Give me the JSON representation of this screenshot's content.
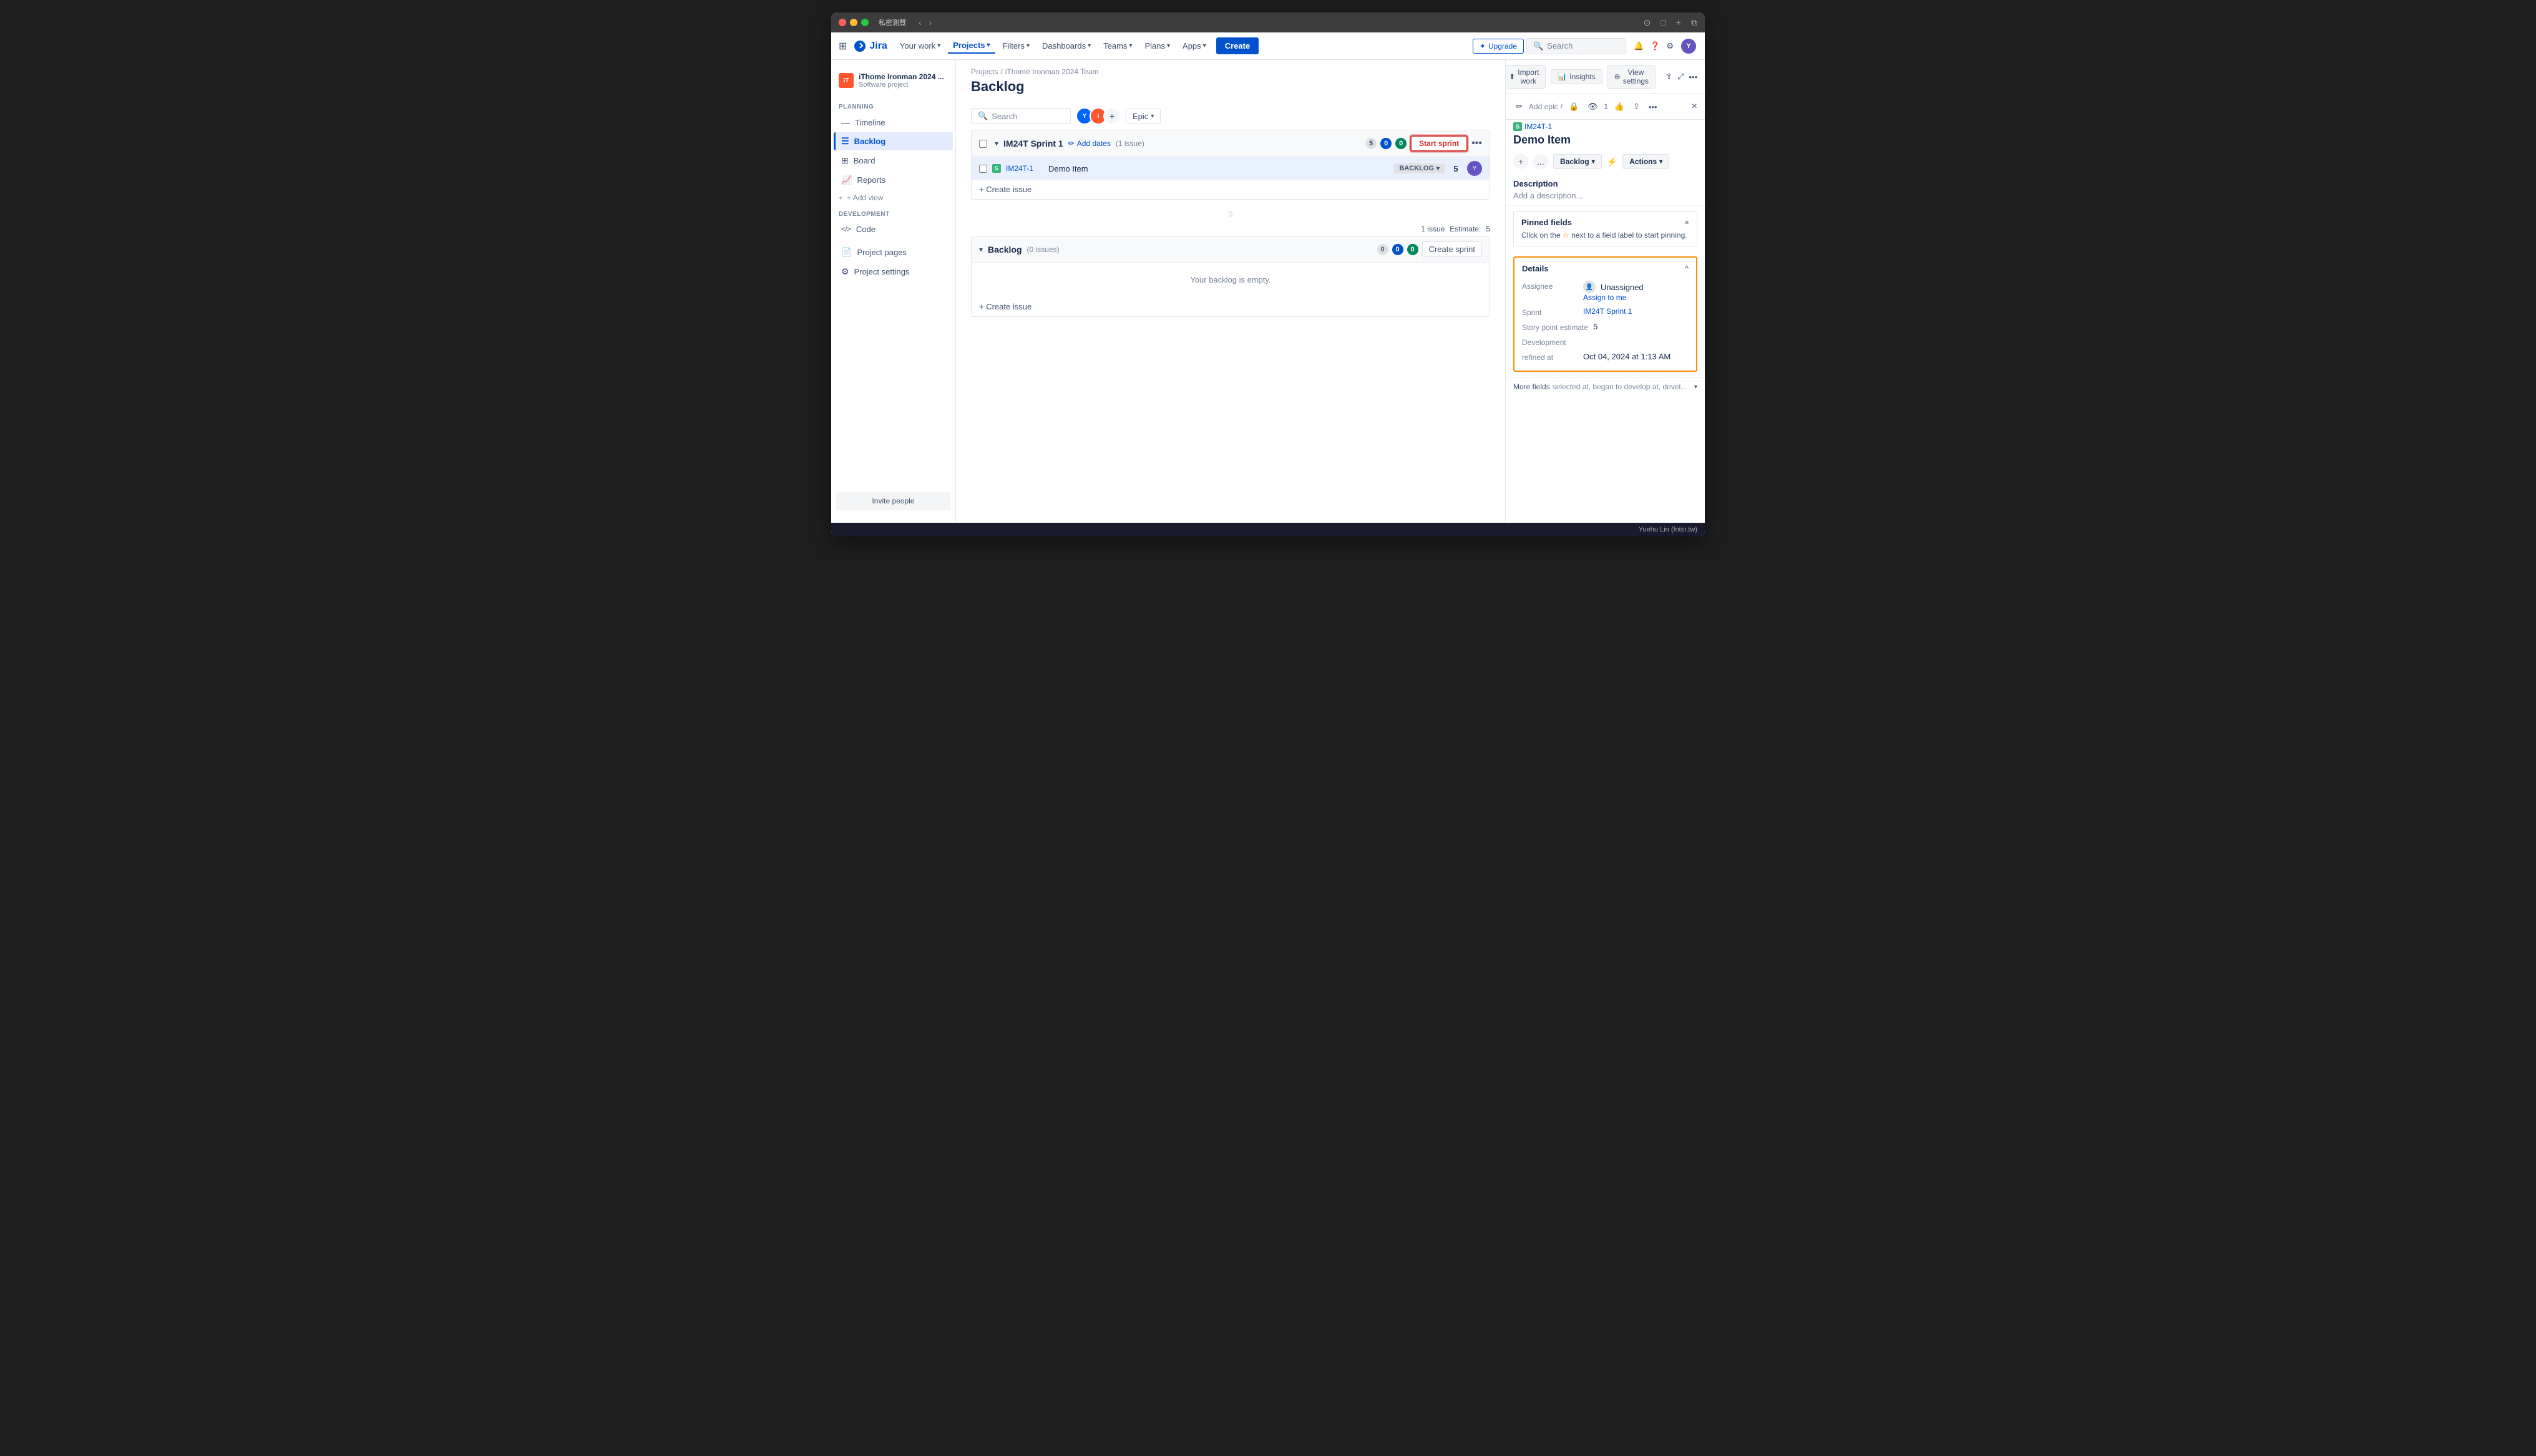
{
  "window": {
    "title": "私密測覽",
    "traffic_lights": [
      "red",
      "yellow",
      "green"
    ]
  },
  "navbar": {
    "logo": "Jira",
    "items": [
      {
        "label": "Your work",
        "id": "your-work",
        "active": false,
        "has_dropdown": true
      },
      {
        "label": "Projects",
        "id": "projects",
        "active": true,
        "has_dropdown": true
      },
      {
        "label": "Filters",
        "id": "filters",
        "active": false,
        "has_dropdown": true
      },
      {
        "label": "Dashboards",
        "id": "dashboards",
        "active": false,
        "has_dropdown": true
      },
      {
        "label": "Teams",
        "id": "teams",
        "active": false,
        "has_dropdown": true
      },
      {
        "label": "Plans",
        "id": "plans",
        "active": false,
        "has_dropdown": true
      },
      {
        "label": "Apps",
        "id": "apps",
        "active": false,
        "has_dropdown": true
      }
    ],
    "create_label": "Create",
    "search_placeholder": "Search",
    "upgrade_label": "Upgrade"
  },
  "sidebar": {
    "project_name": "iThome Ironman 2024 ...",
    "project_type": "Software project",
    "project_icon_text": "iT",
    "planning_label": "PLANNING",
    "nav_items": [
      {
        "label": "Timeline",
        "id": "timeline",
        "active": false,
        "icon": "📅"
      },
      {
        "label": "Backlog",
        "id": "backlog",
        "active": true,
        "icon": "☰"
      },
      {
        "label": "Board",
        "id": "board",
        "active": false,
        "icon": "⊞"
      },
      {
        "label": "Reports",
        "id": "reports",
        "active": false,
        "icon": "📈"
      }
    ],
    "add_view_label": "+ Add view",
    "development_label": "DEVELOPMENT",
    "dev_items": [
      {
        "label": "Code",
        "id": "code",
        "active": false,
        "icon": "</>"
      }
    ],
    "pages_label": "Project pages",
    "settings_label": "Project settings",
    "invite_label": "Invite people"
  },
  "breadcrumb": {
    "projects_link": "Projects",
    "separator": "/",
    "project_link": "iThome Ironman 2024 Team"
  },
  "page": {
    "title": "Backlog"
  },
  "toolbar": {
    "search_placeholder": "Search",
    "epic_label": "Epic"
  },
  "sprint": {
    "title": "IM24T Sprint 1",
    "add_dates_label": "Add dates",
    "issue_count_label": "(1 issue)",
    "badge_total": "5",
    "badge_done": "0",
    "badge_in_progress": "0",
    "start_sprint_label": "Start sprint",
    "issues": [
      {
        "key": "IM24T-1",
        "summary": "Demo Item",
        "status": "BACKLOG",
        "points": "5",
        "type_icon": "S"
      }
    ],
    "create_issue_label": "+ Create issue"
  },
  "stats": {
    "issue_count": "1 issue",
    "estimate_label": "Estimate:",
    "estimate_value": "5"
  },
  "backlog": {
    "title": "Backlog",
    "issue_count": "(0 issues)",
    "badge_done": "0",
    "badge_blue": "0",
    "badge_green": "0",
    "create_sprint_label": "Create sprint",
    "empty_text": "Your backlog is empty.",
    "create_issue_label": "+ Create issue"
  },
  "panel": {
    "toolbar_icons": [
      "share",
      "expand",
      "more"
    ],
    "import_work_label": "Import work",
    "insights_label": "Insights",
    "view_settings_label": "View settings",
    "add_epic_label": "Add epic",
    "separator": "/",
    "issue_id": "IM24T-1",
    "lock_icon": true,
    "watch_count": "1",
    "title": "Demo Item",
    "add_btn": "+",
    "more_btn": "...",
    "status_label": "Backlog",
    "actions_label": "Actions",
    "description_title": "Description",
    "description_empty": "Add a description...",
    "pinned_fields_title": "Pinned fields",
    "pinned_close": "×",
    "pinned_text": "Click on the ☆ next to a field label to start pinning.",
    "details_title": "Details",
    "details_expand": "^",
    "assignee_label": "Assignee",
    "assignee_value": "Unassigned",
    "assign_me_label": "Assign to me",
    "sprint_label": "Sprint",
    "sprint_value": "IM24T Sprint 1",
    "story_point_label": "Story point estimate",
    "story_point_value": "5",
    "development_label": "Development",
    "refined_at_label": "refined at",
    "refined_at_value": "Oct 04, 2024 at 1:13 AM",
    "more_fields_label": "More fields",
    "more_fields_sub": "selected at, began to develop at, devel..."
  },
  "footer": {
    "user": "Yuehu Lin (fntsr.tw)"
  }
}
